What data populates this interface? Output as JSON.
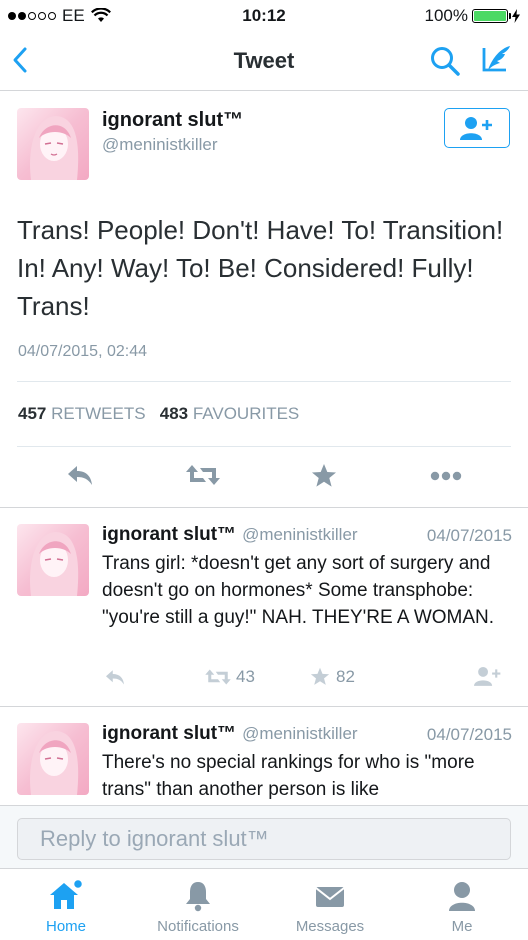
{
  "status_bar": {
    "carrier": "EE",
    "time": "10:12",
    "battery": "100%"
  },
  "nav": {
    "title": "Tweet"
  },
  "main_tweet": {
    "name": "ignorant slut™",
    "handle": "@meninistkiller",
    "text": "Trans! People! Don't! Have! To! Transition! In! Any! Way! To! Be! Considered! Fully! Trans!",
    "date": "04/07/2015, 02:44",
    "retweets_count": "457",
    "retweets_label": "RETWEETS",
    "favourites_count": "483",
    "favourites_label": "FAVOURITES"
  },
  "replies": [
    {
      "name": "ignorant slut™",
      "handle": "@meninistkiller",
      "date": "04/07/2015",
      "text": "Trans girl: *doesn't get any sort of surgery and doesn't go on hormones* Some transphobe: \"you're still a guy!\" NAH. THEY'RE A WOMAN.",
      "retweets": "43",
      "favourites": "82"
    },
    {
      "name": "ignorant slut™",
      "handle": "@meninistkiller",
      "date": "04/07/2015",
      "text": "There's no special rankings for who is \"more trans\" than another person is like"
    }
  ],
  "composer": {
    "placeholder": "Reply to ignorant slut™"
  },
  "tabs": [
    {
      "label": "Home",
      "icon": "home-icon"
    },
    {
      "label": "Notifications",
      "icon": "bell-icon"
    },
    {
      "label": "Messages",
      "icon": "envelope-icon"
    },
    {
      "label": "Me",
      "icon": "person-icon"
    }
  ],
  "colors": {
    "accent": "#1da1f2",
    "muted": "#8899a6",
    "battery": "#4cd964"
  }
}
